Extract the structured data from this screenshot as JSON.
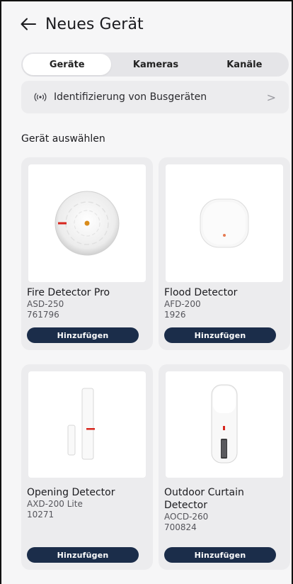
{
  "header": {
    "title": "Neues Gerät",
    "back_icon": "arrow-left-icon"
  },
  "tabs": [
    {
      "label": "Geräte",
      "active": true
    },
    {
      "label": "Kameras",
      "active": false
    },
    {
      "label": "Kanäle",
      "active": false
    }
  ],
  "bus_scan": {
    "label": "Identifizierung von Busgeräten",
    "icon": "broadcast-icon",
    "chevron": ">"
  },
  "section": {
    "title": "Gerät auswählen"
  },
  "devices": [
    {
      "name": "Fire Detector Pro",
      "model": "ASD-250",
      "code": "761796",
      "button": "Hinzufügen"
    },
    {
      "name": "Flood Detector",
      "model": "AFD-200",
      "code": "1926",
      "button": "Hinzufügen"
    },
    {
      "name": "Opening Detector",
      "model": "AXD-200 Lite",
      "code": "10271",
      "button": "Hinzufügen"
    },
    {
      "name_line1": "Outdoor Curtain",
      "name_line2": "Detector",
      "model": "AOCD-260",
      "code": "700824",
      "button": "Hinzufügen"
    }
  ],
  "colors": {
    "button_bg": "#1b2d4a",
    "accent_red": "#d7261e",
    "page_bg": "#f6f6f7"
  }
}
